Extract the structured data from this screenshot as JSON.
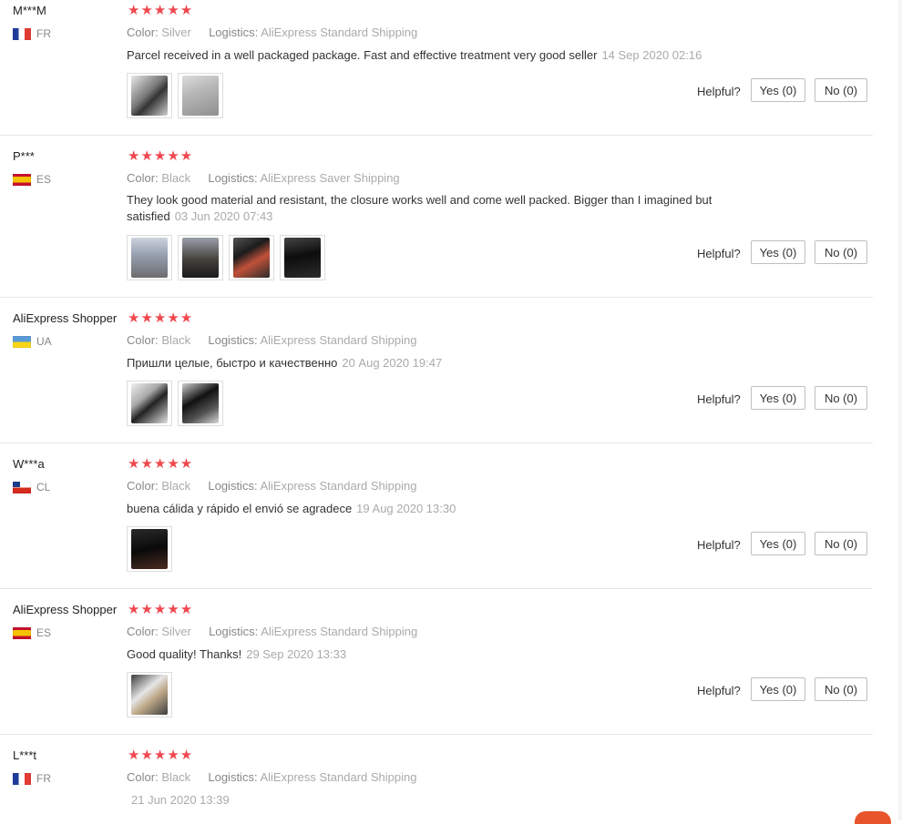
{
  "labels": {
    "color": "Color:",
    "logistics": "Logistics:",
    "helpful": "Helpful?",
    "yes": "Yes (0)",
    "no": "No (0)"
  },
  "rating_stars": "★★★★★",
  "reviews": [
    {
      "user": "M***M",
      "country": "FR",
      "color": "Silver",
      "logistics": "AliExpress Standard Shipping",
      "text": "Parcel received in a well packaged package. Fast and effective treatment very good seller",
      "date": "14 Sep 2020 02:16",
      "photos": 2
    },
    {
      "user": "P***",
      "country": "ES",
      "color": "Black",
      "logistics": "AliExpress Saver Shipping",
      "text": "They look good material and resistant, the closure works well and come well packed. Bigger than I imagined but satisfied",
      "date": "03 Jun 2020 07:43",
      "photos": 4
    },
    {
      "user": "AliExpress Shopper",
      "country": "UA",
      "color": "Black",
      "logistics": "AliExpress Standard Shipping",
      "text": "Пришли целые, быстро и качественно",
      "date": "20 Aug 2020 19:47",
      "photos": 2
    },
    {
      "user": "W***a",
      "country": "CL",
      "color": "Black",
      "logistics": "AliExpress Standard Shipping",
      "text": "buena cálida y rápido el envió se agradece",
      "date": "19 Aug 2020 13:30",
      "photos": 1
    },
    {
      "user": "AliExpress Shopper",
      "country": "ES",
      "color": "Silver",
      "logistics": "AliExpress Standard Shipping",
      "text": "Good quality! Thanks!",
      "date": "29 Sep 2020 13:33",
      "photos": 1
    },
    {
      "user": "L***t",
      "country": "FR",
      "color": "Black",
      "logistics": "AliExpress Standard Shipping",
      "text": "",
      "date": "21 Jun 2020 13:39",
      "photos": 0
    }
  ]
}
